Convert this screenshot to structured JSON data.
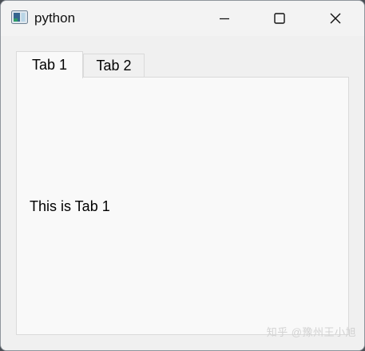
{
  "window": {
    "title": "python",
    "icon": "python-app-icon",
    "controls": {
      "minimize_icon": "minimize-icon",
      "maximize_icon": "maximize-icon",
      "close_icon": "close-icon"
    }
  },
  "tabs": [
    {
      "label": "Tab 1",
      "selected": true
    },
    {
      "label": "Tab 2",
      "selected": false
    }
  ],
  "content": {
    "text": "This is Tab 1"
  },
  "watermark": "知乎 @豫州王小旭",
  "colors": {
    "titlebar": "#f3f3f3",
    "client_background": "#f0f0f0",
    "pane_background": "#f9f9f9",
    "border": "#dadada"
  }
}
